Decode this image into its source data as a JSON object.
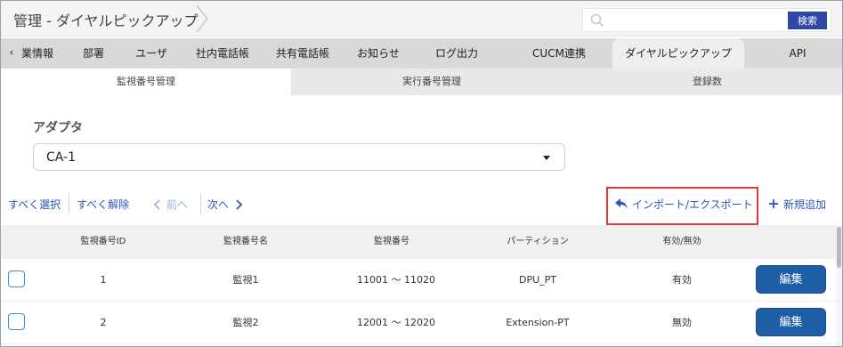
{
  "header": {
    "title": "管理 - ダイヤルピックアップ",
    "search": {
      "value": "",
      "placeholder": "",
      "button_label": "検索"
    }
  },
  "tabs": {
    "prev_label": "‹",
    "items": [
      {
        "label": "業情報"
      },
      {
        "label": "部署"
      },
      {
        "label": "ユーザ"
      },
      {
        "label": "社内電話帳"
      },
      {
        "label": "共有電話帳"
      },
      {
        "label": "お知らせ"
      },
      {
        "label": "ログ出力"
      },
      {
        "label": "CUCM連携"
      },
      {
        "label": "ダイヤルピックアップ"
      },
      {
        "label": "API"
      }
    ],
    "active_index": 8
  },
  "subtabs": [
    {
      "label": "監視番号管理"
    },
    {
      "label": "実行番号管理"
    },
    {
      "label": "登録数"
    }
  ],
  "adapter": {
    "label": "アダプタ",
    "selected": "CA-1"
  },
  "toolbar": {
    "select_all": "すべく選択",
    "deselect_all": "すべく解除",
    "prev": "前へ",
    "next": "次へ",
    "import_export": "インポート/エクスポート",
    "add_new": "新規追加"
  },
  "table": {
    "columns": [
      "監視番号ID",
      "監視番号名",
      "監視番号",
      "パーティション",
      "有効/無効"
    ],
    "rows": [
      {
        "id": "1",
        "name": "監視1",
        "number": "11001 ～ 11020",
        "partition": "DPU_PT",
        "status": "有効",
        "action": "編集"
      },
      {
        "id": "2",
        "name": "監視2",
        "number": "12001 ～ 12020",
        "partition": "Extension-PT",
        "status": "無効",
        "action": "編集"
      }
    ]
  },
  "colors": {
    "accent": "#2e46a8",
    "link": "#2c56b8",
    "highlight": "#e23a3a",
    "edit_button": "#1d5ea6"
  }
}
